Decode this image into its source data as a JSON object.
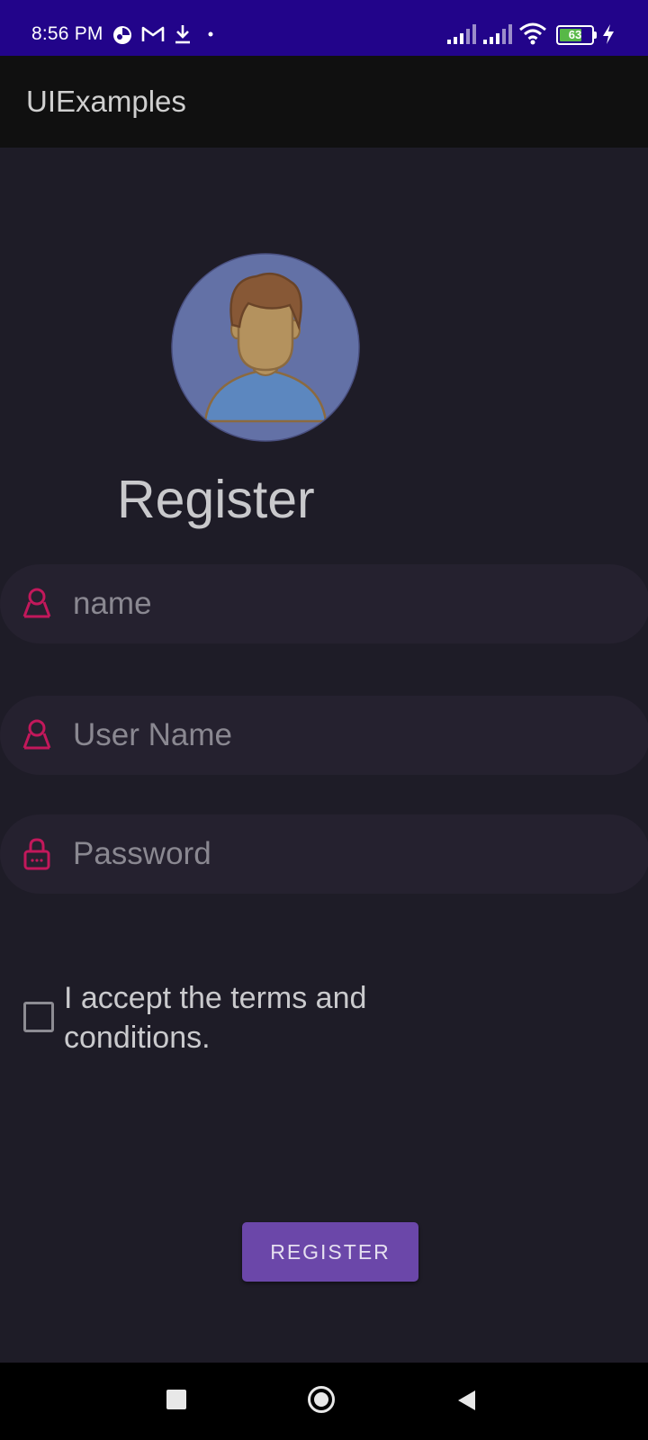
{
  "status_bar": {
    "time": "8:56 PM",
    "battery": "63",
    "icons": [
      "app-notification-icon",
      "gmail-icon",
      "download-icon",
      "dot-icon",
      "signal-icon",
      "signal-icon",
      "wifi-icon",
      "battery-icon",
      "charging-icon"
    ]
  },
  "app_bar": {
    "title": "UIExamples"
  },
  "form": {
    "heading": "Register",
    "name_placeholder": "name",
    "username_placeholder": "User Name",
    "password_placeholder": "Password",
    "terms_label": " I accept the terms and conditions.",
    "submit_label": "REGISTER"
  },
  "colors": {
    "status_bar": "#22048a",
    "app_bar": "#101010",
    "background": "#1e1c27",
    "field_background": "#25212f",
    "icon_accent": "#c2185b",
    "button": "#6b47a9"
  },
  "nav_bar": {
    "icons": [
      "recents-square-icon",
      "home-circle-icon",
      "back-triangle-icon"
    ]
  }
}
